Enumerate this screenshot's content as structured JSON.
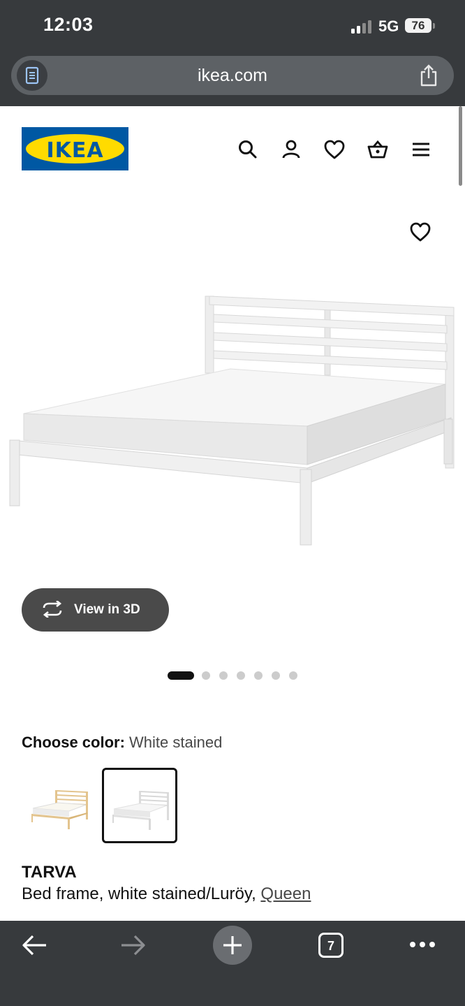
{
  "status_bar": {
    "time": "12:03",
    "network": "5G",
    "battery": "76"
  },
  "browser": {
    "url": "ikea.com",
    "tab_count": "7"
  },
  "header": {
    "logo_text": "IKEA"
  },
  "gallery": {
    "view_3d_label": "View in 3D",
    "image_count": 7,
    "active_image": 1
  },
  "product": {
    "choose_color_label": "Choose color:",
    "selected_color": "White stained",
    "name": "TARVA",
    "description": "Bed frame, white stained/Luröy,",
    "size_link": "Queen"
  },
  "colors": {
    "ikea_blue": "#0058a3",
    "ikea_yellow": "#ffdb00",
    "browser_chrome": "#373a3d"
  }
}
